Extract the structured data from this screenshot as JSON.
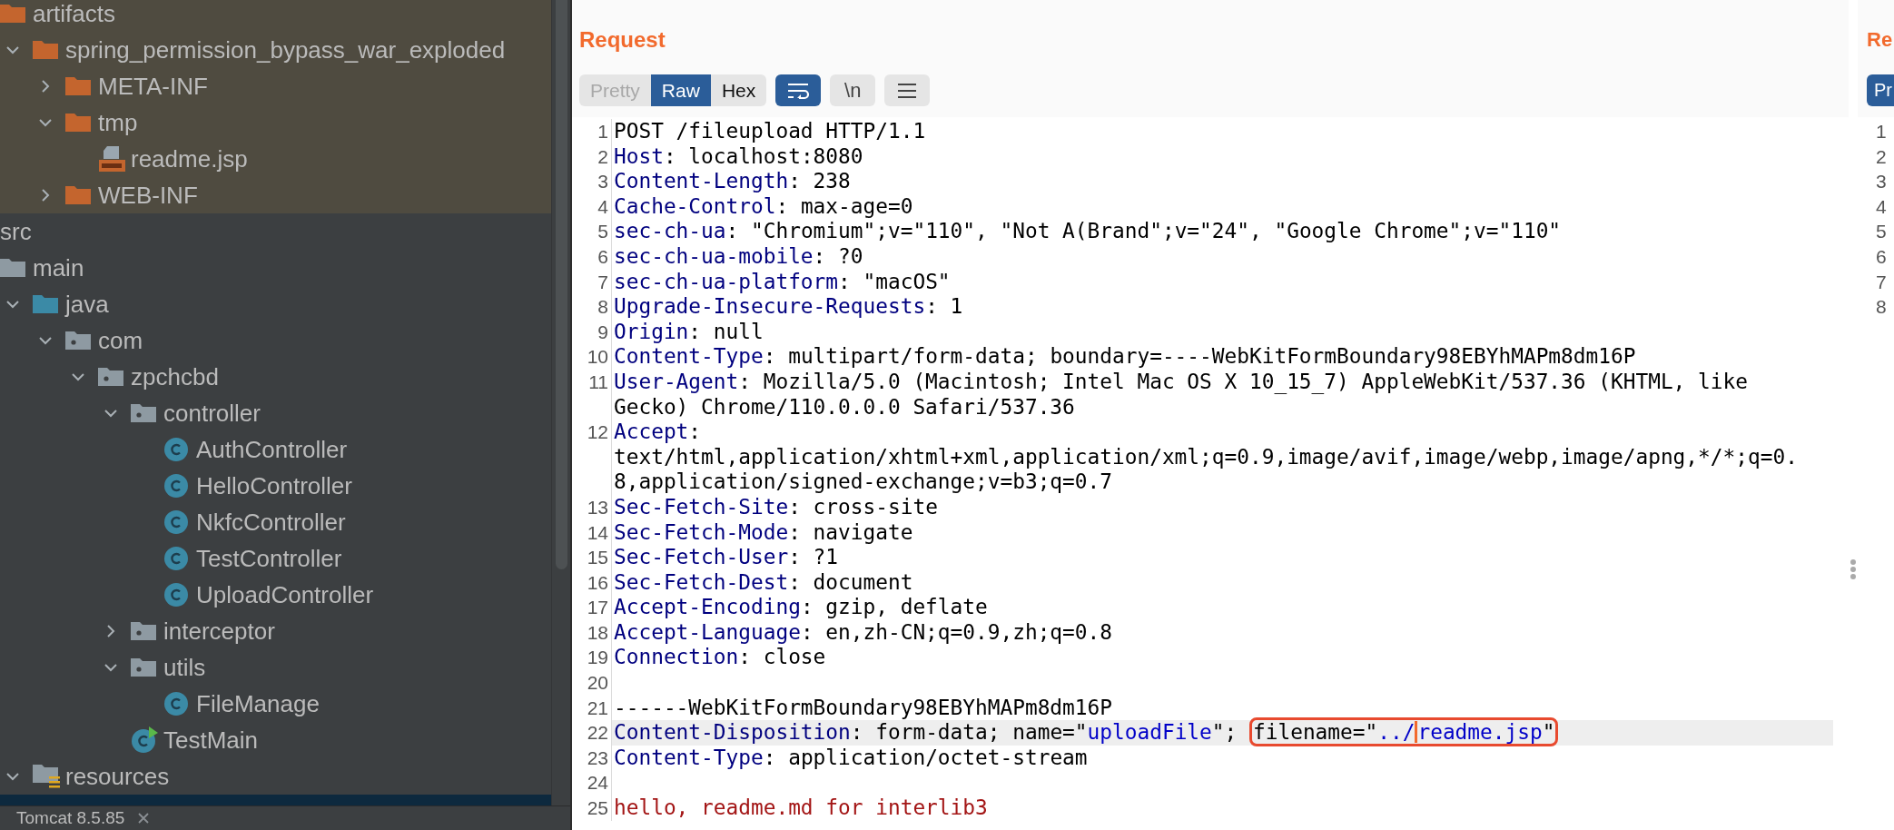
{
  "project_tree": {
    "items": [
      {
        "children": [
          {
            "label": "artifacts",
            "kind": "output-folder",
            "excluded": true,
            "selected": false,
            "children": [
              {
                "label": "spring_permission_bypass_war_exploded",
                "kind": "output-folder",
                "expanded": true,
                "excluded": true,
                "selected": false,
                "children": [
                  {
                    "label": "META-INF",
                    "kind": "output-folder",
                    "expanded": false,
                    "excluded": true,
                    "selected": false
                  },
                  {
                    "label": "tmp",
                    "kind": "output-folder",
                    "expanded": true,
                    "excluded": true,
                    "selected": false,
                    "children": [
                      {
                        "label": "readme.jsp",
                        "kind": "jsp-file",
                        "excluded": true,
                        "selected": false
                      }
                    ]
                  },
                  {
                    "label": "WEB-INF",
                    "kind": "output-folder",
                    "expanded": false,
                    "excluded": true,
                    "selected": false
                  }
                ]
              }
            ]
          }
        ]
      },
      {
        "label": "src",
        "excluded": false,
        "selected": false,
        "children": [
          {
            "label": "main",
            "kind": "folder",
            "excluded": false,
            "selected": false,
            "children": [
              {
                "label": "java",
                "kind": "source-root",
                "expanded": true,
                "excluded": false,
                "selected": false,
                "children": [
                  {
                    "label": "com",
                    "kind": "package",
                    "expanded": true,
                    "excluded": false,
                    "selected": false,
                    "children": [
                      {
                        "label": "zpchcbd",
                        "kind": "package",
                        "expanded": true,
                        "excluded": false,
                        "selected": false,
                        "children": [
                          {
                            "label": "controller",
                            "kind": "package",
                            "expanded": true,
                            "excluded": false,
                            "selected": false,
                            "children": [
                              {
                                "label": "AuthController",
                                "kind": "class",
                                "excluded": false,
                                "selected": false
                              },
                              {
                                "label": "HelloController",
                                "kind": "class",
                                "excluded": false,
                                "selected": false
                              },
                              {
                                "label": "NkfcController",
                                "kind": "class",
                                "excluded": false,
                                "selected": false
                              },
                              {
                                "label": "TestController",
                                "kind": "class",
                                "excluded": false,
                                "selected": false
                              },
                              {
                                "label": "UploadController",
                                "kind": "class",
                                "excluded": false,
                                "selected": false
                              }
                            ]
                          },
                          {
                            "label": "interceptor",
                            "kind": "package",
                            "expanded": false,
                            "excluded": false,
                            "selected": false
                          },
                          {
                            "label": "utils",
                            "kind": "package",
                            "expanded": true,
                            "excluded": false,
                            "selected": false,
                            "children": [
                              {
                                "label": "FileManage",
                                "kind": "class",
                                "excluded": false,
                                "selected": false
                              }
                            ]
                          },
                          {
                            "label": "TestMain",
                            "kind": "main-class",
                            "excluded": false,
                            "selected": false
                          }
                        ]
                      }
                    ]
                  }
                ]
              },
              {
                "label": "resources",
                "kind": "resources-root",
                "expanded": true,
                "excluded": false,
                "selected": false,
                "children": [
                  {
                    "excluded": false,
                    "selected": true
                  }
                ]
              }
            ]
          }
        ]
      }
    ]
  },
  "run_tab": {
    "label": "Tomcat 8.5.85"
  },
  "request_editor": {
    "title": "Request",
    "view_tabs": [
      {
        "label": "Pretty",
        "selected": false,
        "disabled": true
      },
      {
        "label": "Raw",
        "selected": true,
        "disabled": false
      },
      {
        "label": "Hex",
        "selected": false,
        "disabled": false
      }
    ],
    "toggles": [
      {
        "kind": "wrap",
        "on": true
      },
      {
        "kind": "newlines",
        "label": "\\n",
        "on": false
      },
      {
        "kind": "menu",
        "on": false
      }
    ],
    "lines": [
      {
        "number": "1",
        "highlighted": false,
        "parts": [
          {
            "kind": "plain",
            "text": "POST /fileupload HTTP/1.1"
          }
        ]
      },
      {
        "number": "2",
        "highlighted": false,
        "parts": [
          {
            "kind": "name",
            "text": "Host"
          },
          {
            "kind": "plain",
            "text": ": localhost:8080"
          }
        ]
      },
      {
        "number": "3",
        "highlighted": false,
        "parts": [
          {
            "kind": "name",
            "text": "Content-Length"
          },
          {
            "kind": "plain",
            "text": ": 238"
          }
        ]
      },
      {
        "number": "4",
        "highlighted": false,
        "parts": [
          {
            "kind": "name",
            "text": "Cache-Control"
          },
          {
            "kind": "plain",
            "text": ": max-age=0"
          }
        ]
      },
      {
        "number": "5",
        "highlighted": false,
        "parts": [
          {
            "kind": "name",
            "text": "sec-ch-ua"
          },
          {
            "kind": "plain",
            "text": ": \"Chromium\";v=\"110\", \"Not A(Brand\";v=\"24\", \"Google Chrome\";v=\"110\""
          }
        ]
      },
      {
        "number": "6",
        "highlighted": false,
        "parts": [
          {
            "kind": "name",
            "text": "sec-ch-ua-mobile"
          },
          {
            "kind": "plain",
            "text": ": ?0"
          }
        ]
      },
      {
        "number": "7",
        "highlighted": false,
        "parts": [
          {
            "kind": "name",
            "text": "sec-ch-ua-platform"
          },
          {
            "kind": "plain",
            "text": ": \"macOS\""
          }
        ]
      },
      {
        "number": "8",
        "highlighted": false,
        "parts": [
          {
            "kind": "name",
            "text": "Upgrade-Insecure-Requests"
          },
          {
            "kind": "plain",
            "text": ": 1"
          }
        ]
      },
      {
        "number": "9",
        "highlighted": false,
        "parts": [
          {
            "kind": "name",
            "text": "Origin"
          },
          {
            "kind": "plain",
            "text": ": null"
          }
        ]
      },
      {
        "number": "10",
        "highlighted": false,
        "parts": [
          {
            "kind": "name",
            "text": "Content-Type"
          },
          {
            "kind": "plain",
            "text": ": multipart/form-data; boundary=----WebKitFormBoundary98EBYhMAPm8dm16P"
          }
        ]
      },
      {
        "number": "11",
        "highlighted": false,
        "parts": [
          {
            "kind": "name",
            "text": "User-Agent"
          },
          {
            "kind": "plain",
            "text": ": Mozilla/5.0 (Macintosh; Intel Mac OS X 10_15_7) AppleWebKit/537.36 (KHTML, like Gecko) Chrome/110.0.0.0 Safari/537.36"
          }
        ]
      },
      {
        "number": "12",
        "highlighted": false,
        "parts": [
          {
            "kind": "name",
            "text": "Accept"
          },
          {
            "kind": "plain",
            "text": ": text/html,application/xhtml+xml,application/xml;q=0.9,image/avif,image/webp,image/apng,*/*;q=0.8,application/signed-exchange;v=b3;q=0.7"
          }
        ]
      },
      {
        "number": "13",
        "highlighted": false,
        "parts": [
          {
            "kind": "name",
            "text": "Sec-Fetch-Site"
          },
          {
            "kind": "plain",
            "text": ": cross-site"
          }
        ]
      },
      {
        "number": "14",
        "highlighted": false,
        "parts": [
          {
            "kind": "name",
            "text": "Sec-Fetch-Mode"
          },
          {
            "kind": "plain",
            "text": ": navigate"
          }
        ]
      },
      {
        "number": "15",
        "highlighted": false,
        "parts": [
          {
            "kind": "name",
            "text": "Sec-Fetch-User"
          },
          {
            "kind": "plain",
            "text": ": ?1"
          }
        ]
      },
      {
        "number": "16",
        "highlighted": false,
        "parts": [
          {
            "kind": "name",
            "text": "Sec-Fetch-Dest"
          },
          {
            "kind": "plain",
            "text": ": document"
          }
        ]
      },
      {
        "number": "17",
        "highlighted": false,
        "parts": [
          {
            "kind": "name",
            "text": "Accept-Encoding"
          },
          {
            "kind": "plain",
            "text": ": gzip, deflate"
          }
        ]
      },
      {
        "number": "18",
        "highlighted": false,
        "parts": [
          {
            "kind": "name",
            "text": "Accept-Language"
          },
          {
            "kind": "plain",
            "text": ": en,zh-CN;q=0.9,zh;q=0.8"
          }
        ]
      },
      {
        "number": "19",
        "highlighted": false,
        "parts": [
          {
            "kind": "name",
            "text": "Connection"
          },
          {
            "kind": "plain",
            "text": ": close"
          }
        ]
      },
      {
        "number": "20",
        "highlighted": false
      },
      {
        "number": "21",
        "highlighted": false,
        "parts": [
          {
            "kind": "plain",
            "text": "------WebKitFormBoundary98EBYhMAPm8dm16P"
          }
        ]
      },
      {
        "number": "22",
        "highlighted": true,
        "parts": [
          {
            "kind": "name",
            "text": "Content-Disposition"
          },
          {
            "kind": "plain",
            "text": ": form-data; name=\""
          },
          {
            "kind": "string",
            "text": "uploadFile"
          },
          {
            "kind": "plain",
            "text": "\"; "
          },
          {
            "kind": "boxed",
            "parts": [
              {
                "kind": "plain",
                "text": "filename=\""
              },
              {
                "kind": "string",
                "text": "../"
              },
              {
                "kind": "caret"
              },
              {
                "kind": "string",
                "text": "readme.jsp"
              },
              {
                "kind": "plain",
                "text": "\""
              }
            ]
          }
        ]
      },
      {
        "number": "23",
        "highlighted": false,
        "parts": [
          {
            "kind": "name",
            "text": "Content-Type"
          },
          {
            "kind": "plain",
            "text": ": application/octet-stream"
          }
        ]
      },
      {
        "number": "24",
        "highlighted": false
      },
      {
        "number": "25",
        "highlighted": false,
        "parts": [
          {
            "kind": "body",
            "text": "hello, readme.md for interlib3"
          }
        ]
      }
    ]
  },
  "response_editor": {
    "title": "Re",
    "view_tab": {
      "label": "Pr",
      "selected": true
    },
    "line_numbers": [
      "1",
      "2",
      "3",
      "4",
      "5",
      "6",
      "7",
      "8"
    ]
  }
}
